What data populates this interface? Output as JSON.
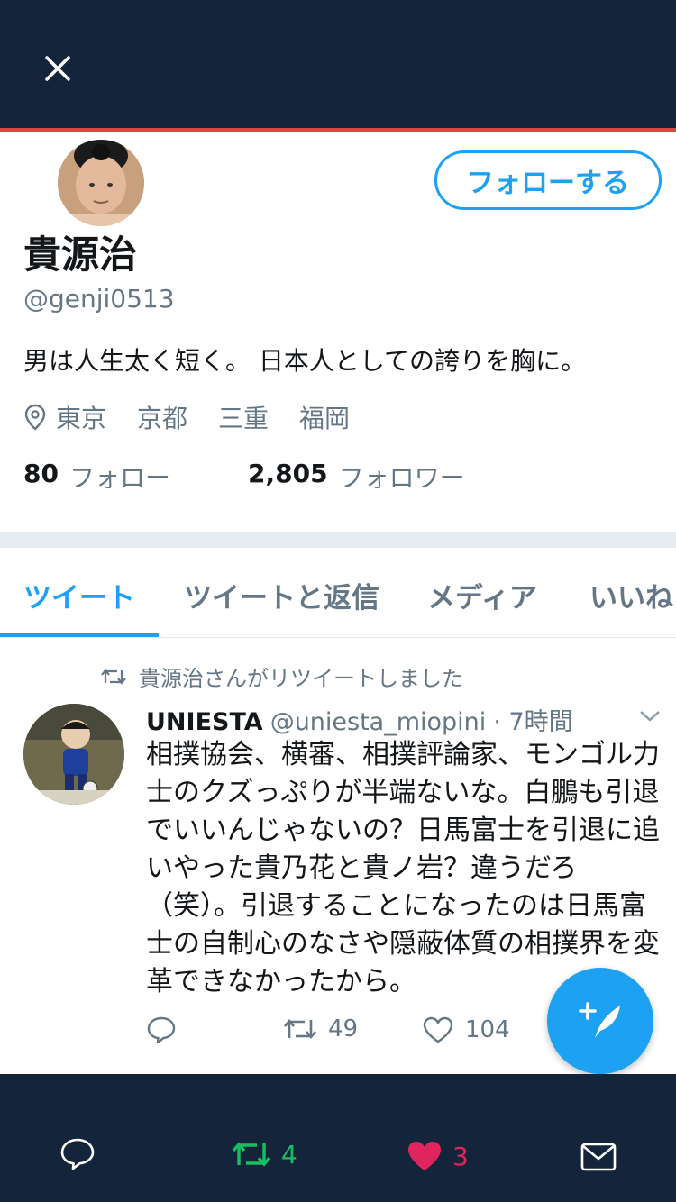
{
  "header": {
    "close_icon": "close-icon"
  },
  "profile": {
    "follow_label": "フォローする",
    "display_name": "貴源治",
    "handle": "@genji0513",
    "bio": "男は人生太く短く。 日本人としての誇りを胸に。",
    "locations": [
      "東京",
      "京都",
      "三重",
      "福岡"
    ],
    "following_count": "80",
    "following_label": "フォロー",
    "followers_count": "2,805",
    "followers_label": "フォロワー"
  },
  "tabs": [
    {
      "label": "ツイート",
      "active": true
    },
    {
      "label": "ツイートと返信",
      "active": false
    },
    {
      "label": "メディア",
      "active": false
    },
    {
      "label": "いいね",
      "active": false
    }
  ],
  "tweet": {
    "retweet_context": "貴源治さんがリツイートしました",
    "author_name": "UNIESTA",
    "author_handle": "@uniesta_miopini",
    "time": "· 7時間",
    "text": "相撲協会、横審、相撲評論家、モンゴル力士のクズっぷりが半端ないな。白鵬も引退でいいんじゃないの？日馬富士を引退に追いやった貴乃花と貴ノ岩？違うだろ（笑）。引退することになったのは日馬富士の自制心のなさや隠蔽体質の相撲界を変革できなかったから。",
    "retweet_count": "49",
    "like_count": "104"
  },
  "bottom_bar": {
    "retweet_count": "4",
    "like_count": "3"
  },
  "colors": {
    "brand_blue": "#1da1f2",
    "navy": "#14243b",
    "retweet_green": "#17bf63",
    "like_pink": "#e0245e",
    "accent_red": "#e0453d"
  }
}
